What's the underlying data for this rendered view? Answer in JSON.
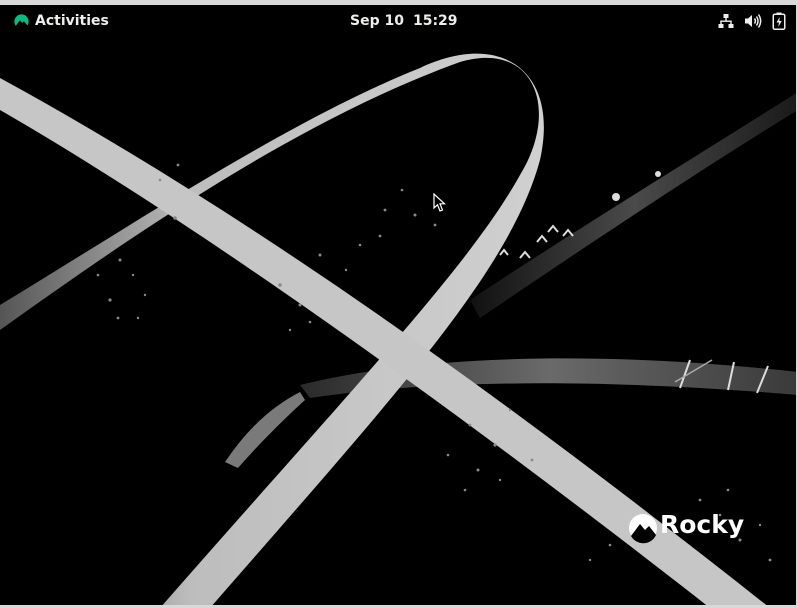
{
  "topbar": {
    "activities_label": "Activities",
    "date": "Sep 10",
    "time": "15:29",
    "tray_icons": [
      "network-wired-icon",
      "volume-icon",
      "battery-icon"
    ]
  },
  "desktop": {
    "brand_text": "Rocky"
  },
  "colors": {
    "topbar_bg": "#000000",
    "topbar_text": "#eeeeec",
    "accent_green": "#10b981",
    "wallpaper_bg": "#000000",
    "ribbon": "#c8c8c8"
  }
}
